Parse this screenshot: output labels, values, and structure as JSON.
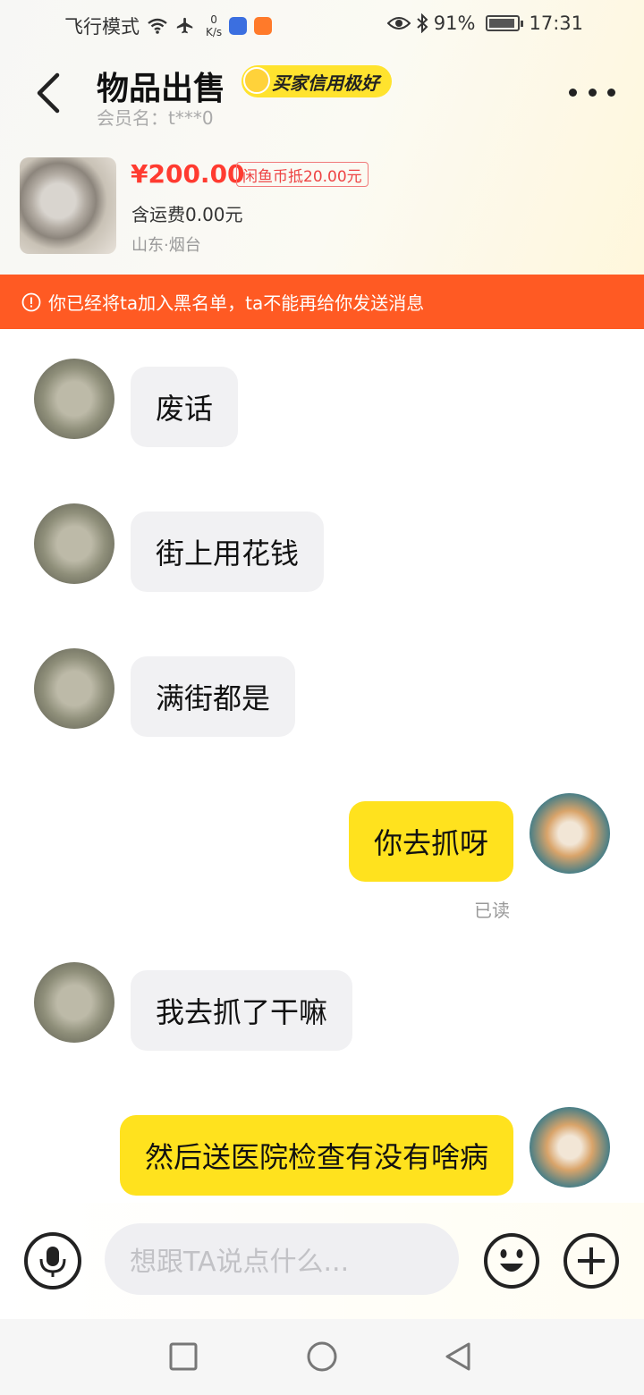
{
  "status_bar": {
    "airplane_mode": "飞行模式",
    "net_speed_value": "0",
    "net_speed_unit": "K/s",
    "battery": "91%",
    "time": "17:31"
  },
  "header": {
    "title": "物品出售",
    "credit_badge": "买家信用极好",
    "member": "会员名：t***0"
  },
  "product": {
    "price": "¥200.00",
    "coin_tag": "闲鱼币抵20.00元",
    "shipping": "含运费0.00元",
    "location": "山东·烟台"
  },
  "banner": {
    "text": "你已经将ta加入黑名单，ta不能再给你发送消息"
  },
  "messages": [
    {
      "sender": "other",
      "text": "废话"
    },
    {
      "sender": "other",
      "text": "街上用花钱"
    },
    {
      "sender": "other",
      "text": "满街都是"
    },
    {
      "sender": "self",
      "text": "你去抓呀",
      "status": "已读"
    },
    {
      "sender": "other",
      "text": "我去抓了干嘛"
    },
    {
      "sender": "self",
      "text": "然后送医院检查有没有啥病"
    }
  ],
  "input": {
    "placeholder": "想跟TA说点什么..."
  },
  "colors": {
    "accent_yellow": "#ffe21e",
    "banner_orange": "#ff5a23",
    "price_red": "#ff3b30"
  },
  "icons": [
    "wifi-icon",
    "airplane-icon",
    "eye-icon",
    "bluetooth-icon",
    "battery-icon",
    "back-arrow-icon",
    "more-icon",
    "warning-icon",
    "microphone-icon",
    "emoji-icon",
    "plus-icon",
    "square-icon",
    "circle-icon",
    "triangle-back-icon"
  ]
}
